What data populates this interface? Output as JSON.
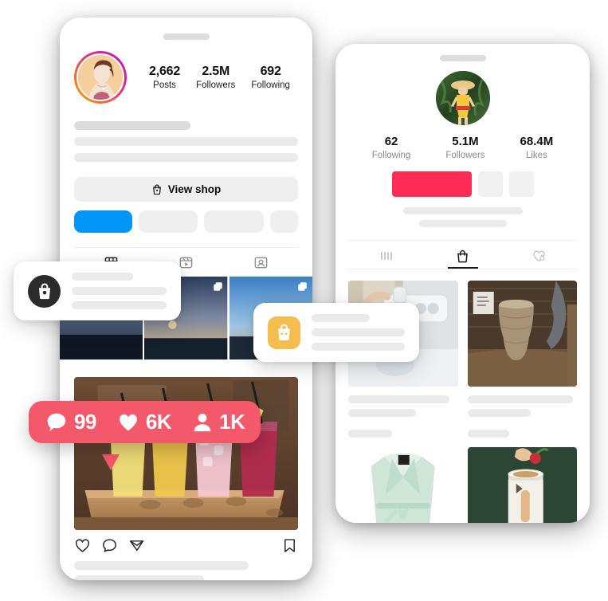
{
  "instagram_phone": {
    "name": "instagram-profile",
    "avatar_alt": "portrait-avatar",
    "stats": [
      {
        "value": "2,662",
        "label": "Posts"
      },
      {
        "value": "2.5M",
        "label": "Followers"
      },
      {
        "value": "692",
        "label": "Following"
      }
    ],
    "view_shop_label": "View shop",
    "tabs": [
      {
        "name": "grid",
        "icon": "grid-icon"
      },
      {
        "name": "reels",
        "icon": "reels-icon"
      },
      {
        "name": "tagged",
        "icon": "tagged-icon"
      }
    ],
    "accent_color": "#0095F6"
  },
  "tiktok_phone": {
    "name": "tiktok-profile",
    "avatar_alt": "beach-portrait-avatar",
    "stats": [
      {
        "value": "62",
        "label": "Following"
      },
      {
        "value": "5.1M",
        "label": "Followers"
      },
      {
        "value": "68.4M",
        "label": "Likes"
      }
    ],
    "tabs": [
      {
        "name": "grid",
        "icon": "grid-bars-icon"
      },
      {
        "name": "shop",
        "icon": "shopping-bag-icon",
        "active": true
      },
      {
        "name": "liked",
        "icon": "locked-heart-icon"
      }
    ],
    "accent_color": "#FE2C55",
    "products": [
      {
        "name": "ice-maker-appliance"
      },
      {
        "name": "ceramic-vase"
      },
      {
        "name": "mint-blazer"
      },
      {
        "name": "white-kitchen-appliance"
      }
    ]
  },
  "floating_cards": [
    {
      "name": "shop-notification-dark",
      "icon": "shopping-bag-icon",
      "icon_color": "#2b2b2b"
    },
    {
      "name": "shop-notification-yellow",
      "icon": "shopping-bag-icon",
      "icon_color": "#F5BD4F"
    }
  ],
  "engagement_badge": {
    "name": "engagement-badge",
    "background": "#F4596B",
    "metrics": [
      {
        "icon": "comment-icon",
        "value": "99"
      },
      {
        "icon": "heart-icon",
        "value": "6K"
      },
      {
        "icon": "person-icon",
        "value": "1K"
      }
    ]
  }
}
